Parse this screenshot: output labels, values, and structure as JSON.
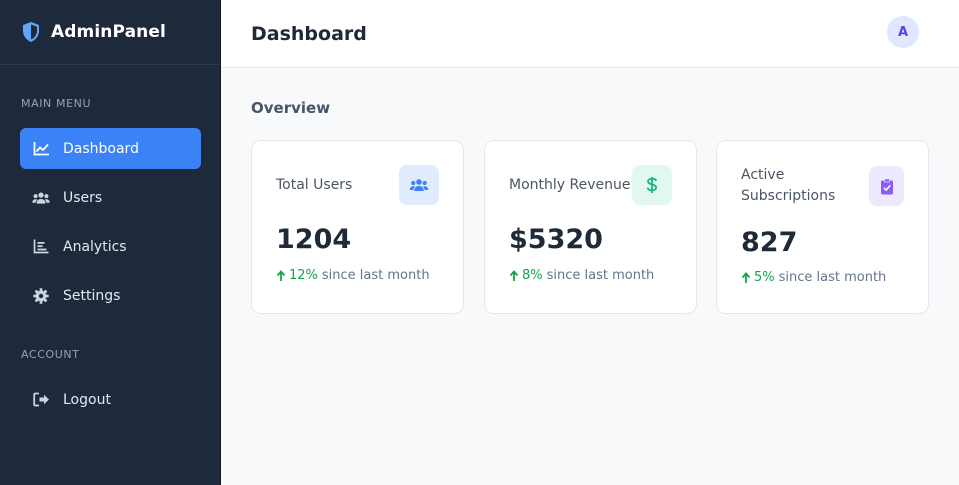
{
  "brand": {
    "name": "AdminPanel",
    "icon": "shield-icon"
  },
  "sidebar": {
    "sections": {
      "main": "MAIN MENU",
      "account": "ACCOUNT"
    },
    "items": [
      {
        "label": "Dashboard",
        "icon": "chart-line-icon",
        "active": true
      },
      {
        "label": "Users",
        "icon": "users-icon",
        "active": false
      },
      {
        "label": "Analytics",
        "icon": "bar-chart-icon",
        "active": false
      },
      {
        "label": "Settings",
        "icon": "gear-icon",
        "active": false
      }
    ],
    "account_items": [
      {
        "label": "Logout",
        "icon": "logout-icon"
      }
    ]
  },
  "header": {
    "title": "Dashboard",
    "avatar_initial": "A"
  },
  "main": {
    "section_title": "Overview",
    "cards": [
      {
        "label": "Total Users",
        "value": "1204",
        "trend_pct": "12%",
        "trend_text": "since last month",
        "icon": "users-icon",
        "accent": "#3b82f6"
      },
      {
        "label": "Monthly Revenue",
        "value": "$5320",
        "trend_pct": "8%",
        "trend_text": "since last month",
        "icon": "dollar-icon",
        "accent": "#10b981"
      },
      {
        "label": "Active Subscriptions",
        "value": "827",
        "trend_pct": "5%",
        "trend_text": "since last month",
        "icon": "clipboard-check-icon",
        "accent": "#8b5cf6"
      }
    ]
  },
  "colors": {
    "sidebar_bg": "#1e293b",
    "active_item": "#3b82f6",
    "trend_up": "#16a34a"
  }
}
